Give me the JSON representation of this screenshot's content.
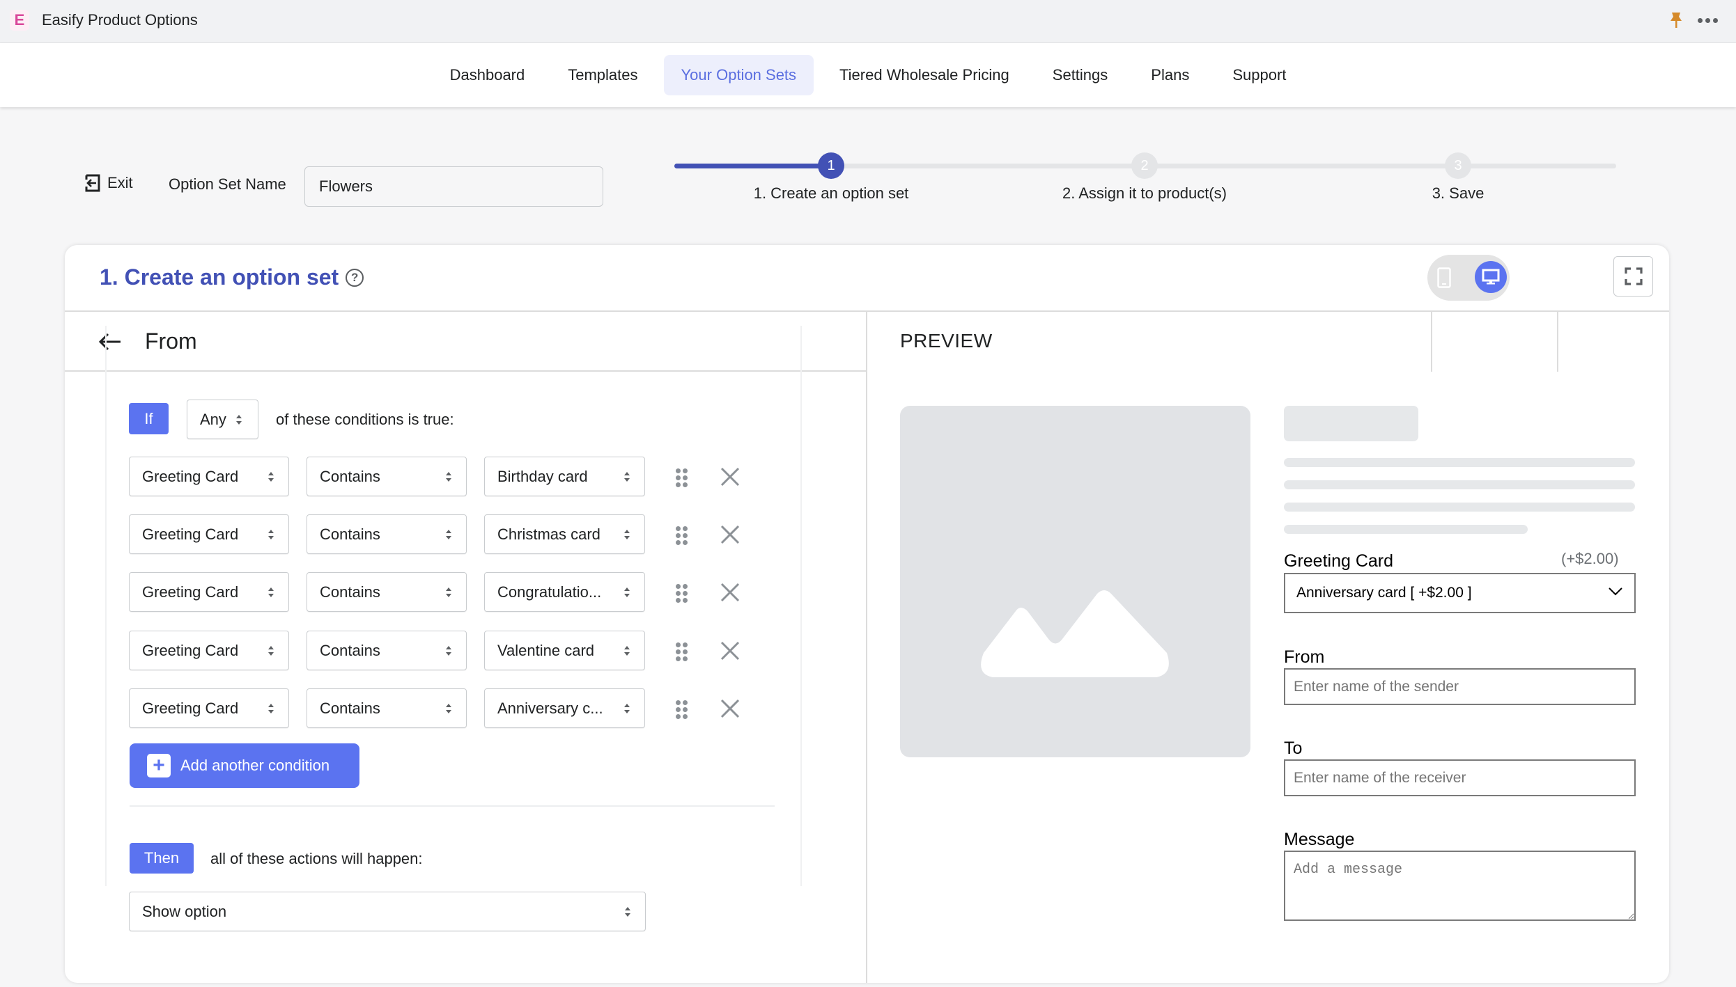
{
  "app": {
    "title": "Easify Product Options",
    "logo_letter": "E"
  },
  "nav": {
    "items": [
      {
        "label": "Dashboard",
        "active": false
      },
      {
        "label": "Templates",
        "active": false
      },
      {
        "label": "Your Option Sets",
        "active": true
      },
      {
        "label": "Tiered Wholesale Pricing",
        "active": false
      },
      {
        "label": "Settings",
        "active": false
      },
      {
        "label": "Plans",
        "active": false
      },
      {
        "label": "Support",
        "active": false
      }
    ]
  },
  "option_set": {
    "exit_label": "Exit",
    "name_label": "Option Set Name",
    "name_value": "Flowers"
  },
  "stepper": {
    "current_step": 1,
    "steps": [
      {
        "number": "1",
        "label": "1. Create an option set"
      },
      {
        "number": "2",
        "label": "2. Assign it to product(s)"
      },
      {
        "number": "3",
        "label": "3. Save"
      }
    ]
  },
  "card": {
    "title": "1. Create an option set",
    "help_glyph": "?"
  },
  "logic": {
    "header_title": "From",
    "if_label": "If",
    "match_mode": "Any",
    "match_suffix": "of these conditions is true:",
    "conditions": [
      {
        "field": "Greeting Card",
        "operator": "Contains",
        "value": "Birthday card"
      },
      {
        "field": "Greeting Card",
        "operator": "Contains",
        "value": "Christmas card"
      },
      {
        "field": "Greeting Card",
        "operator": "Contains",
        "value": "Congratulatio..."
      },
      {
        "field": "Greeting Card",
        "operator": "Contains",
        "value": "Valentine card"
      },
      {
        "field": "Greeting Card",
        "operator": "Contains",
        "value": "Anniversary c..."
      }
    ],
    "add_condition_label": "Add another condition",
    "then_label": "Then",
    "then_suffix": "all of these actions will happen:",
    "action": "Show option"
  },
  "preview": {
    "title": "PREVIEW",
    "device_mode": "desktop",
    "greeting_card": {
      "label": "Greeting Card",
      "price": "(+$2.00)",
      "selected": "Anniversary card [ +$2.00 ]"
    },
    "from": {
      "label": "From",
      "placeholder": "Enter name of the sender"
    },
    "to": {
      "label": "To",
      "placeholder": "Enter name of the receiver"
    },
    "message": {
      "label": "Message",
      "placeholder": "Add a message"
    }
  },
  "colors": {
    "primary": "#4251b5",
    "accent": "#5b73f0",
    "nav_active_bg": "#edeffc",
    "pin": "#d58a2a"
  }
}
